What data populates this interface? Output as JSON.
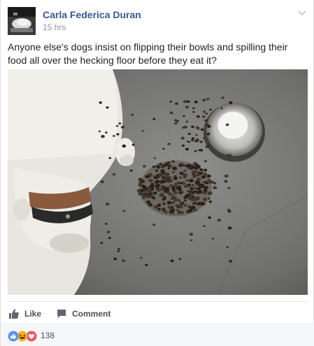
{
  "post": {
    "author": "Carla Federica Duran",
    "timestamp": "15 hrs",
    "text": "Anyone else's dogs insist on flipping their bowls and spilling their food all over the hecking floor before they eat it?",
    "avatar_icon": "profile-photo",
    "menu_icon": "chevron-down-icon",
    "photo_description_icon": "post-photo"
  },
  "actions": {
    "like_label": "Like",
    "comment_label": "Comment"
  },
  "reactions": {
    "icons": [
      "like-reaction-icon",
      "haha-reaction-icon",
      "love-reaction-icon"
    ],
    "count": "138"
  },
  "colors": {
    "link": "#365899",
    "muted": "#90949c",
    "action": "#4b4f56",
    "like_blue": "#5890ff",
    "haha_yellow": "#f7b125",
    "love_red": "#f25268"
  }
}
